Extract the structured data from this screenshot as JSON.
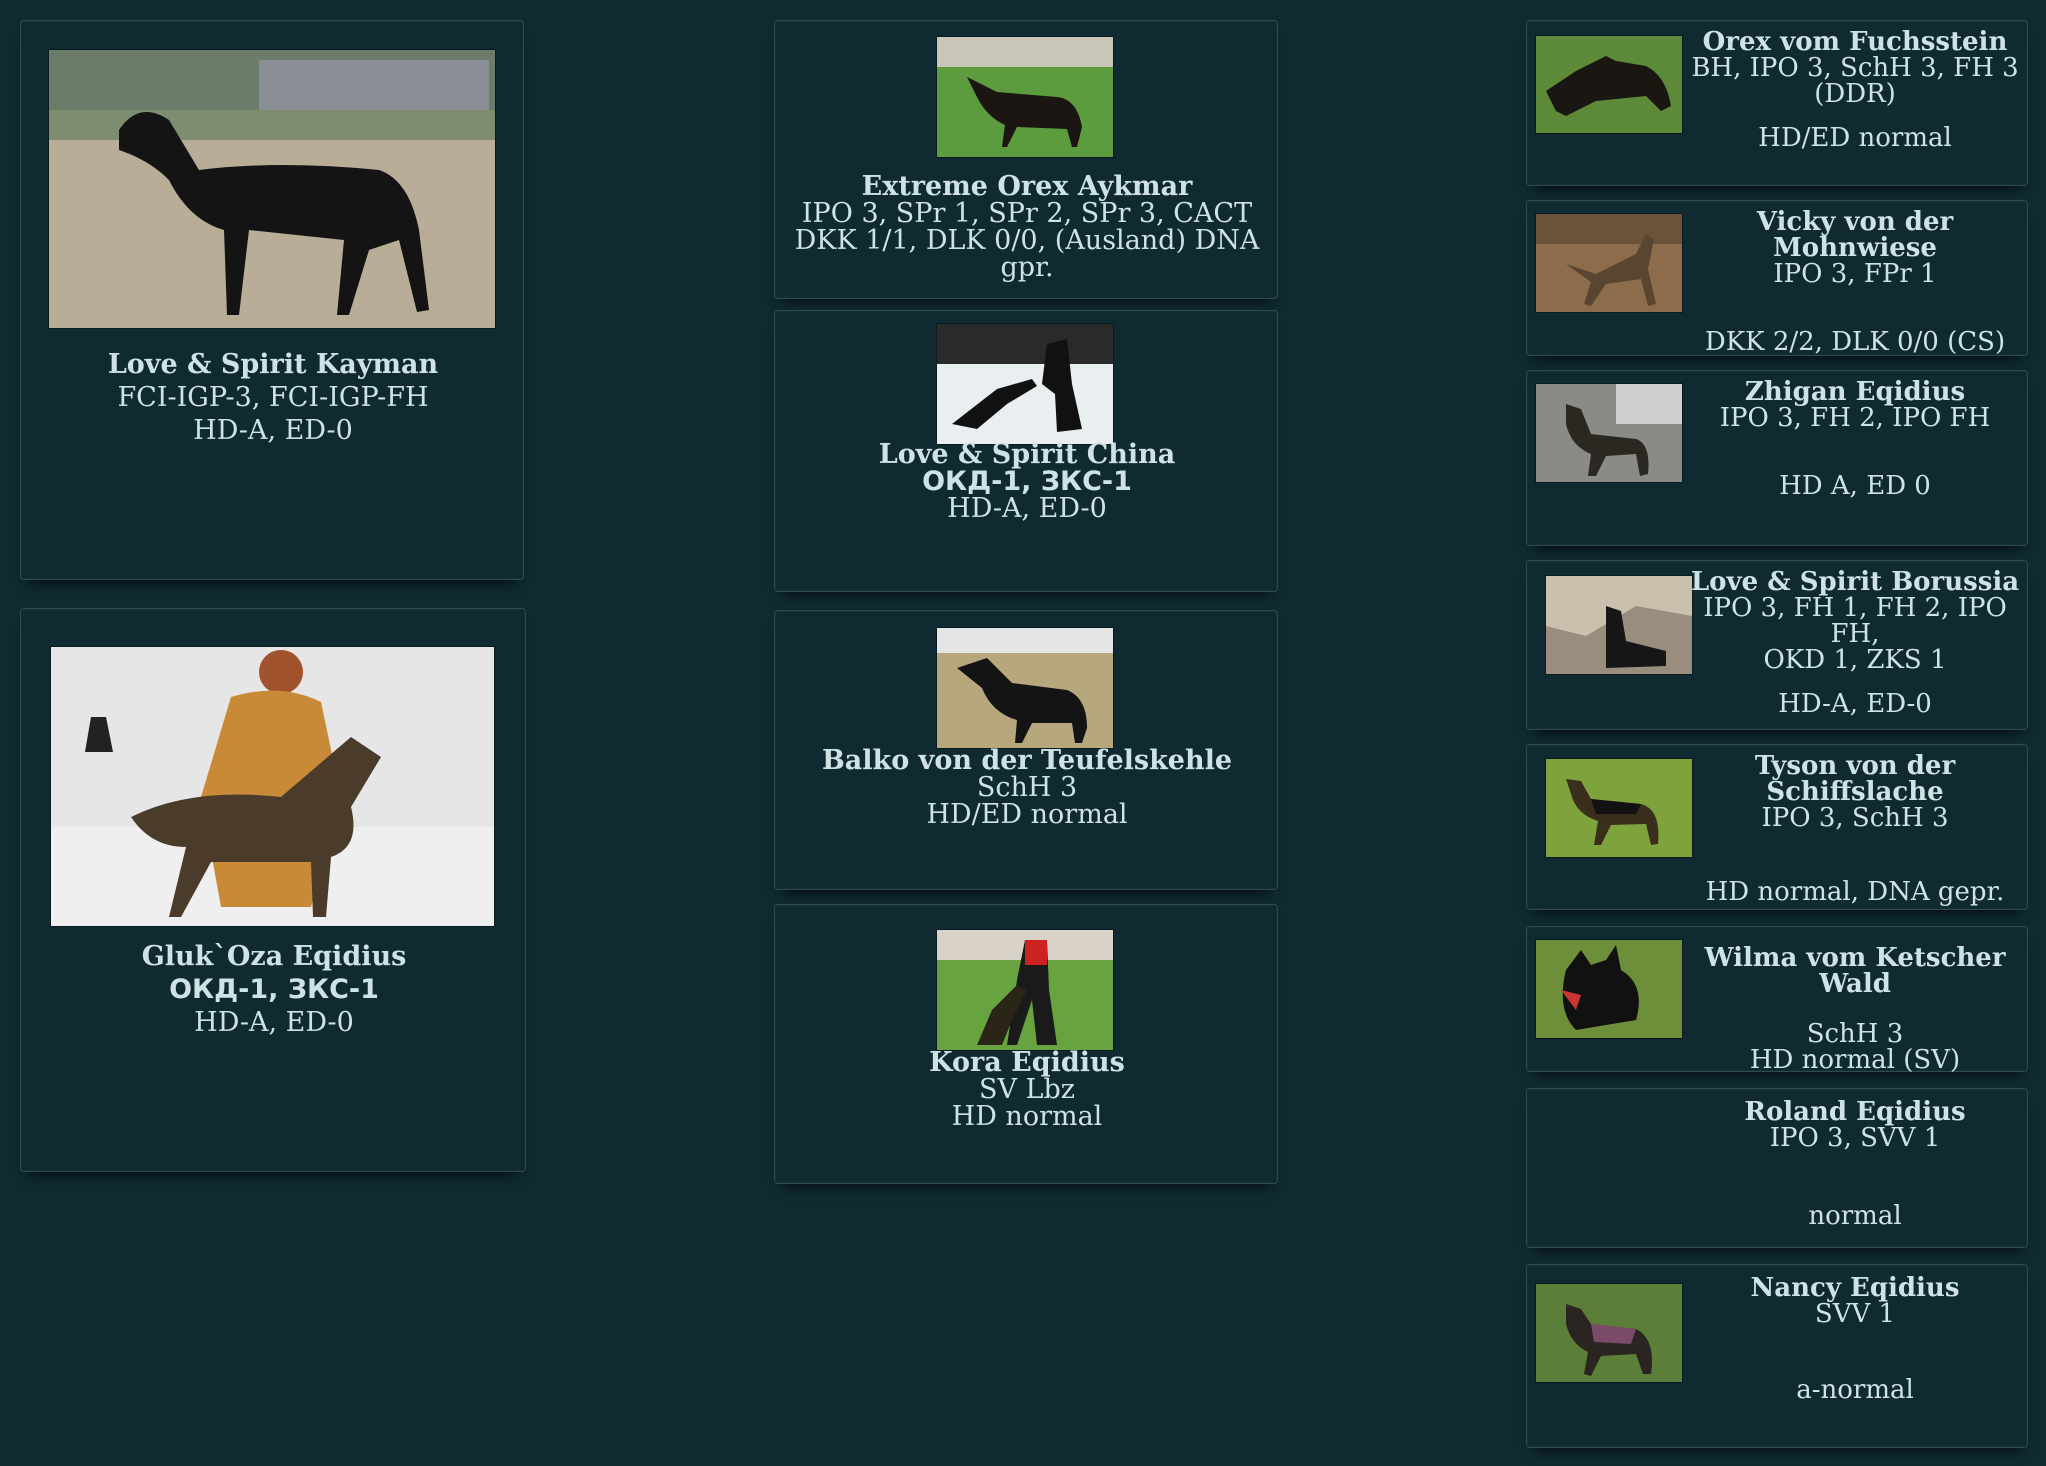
{
  "colors": {
    "background": "#0f2a31",
    "card_border": "#2c4b52",
    "text": "#cfe3e6"
  },
  "dogs": {
    "sire": {
      "name": "Love & Spirit Kayman",
      "titles": "FCI-IGP-3, FCI-IGP-FH",
      "health": "HD-A, ED-0"
    },
    "dam": {
      "name": "Gluk`Oza Eqidius",
      "titles_cyr": "ОКД-1, ЗКС-1",
      "health": "HD-A, ED-0"
    },
    "sire_sire": {
      "name": "Extreme Orex Aykmar",
      "titles": "IPO 3, SPr 1, SPr 2, SPr 3, CACT",
      "health": "DKK 1/1, DLK 0/0, (Ausland) DNA gpr."
    },
    "sire_dam": {
      "name": "Love & Spirit China",
      "titles_cyr": "ОКД-1, ЗКС-1",
      "health": "HD-A, ED-0"
    },
    "dam_sire": {
      "name": "Balko von der Teufelskehle",
      "titles": "SchH 3",
      "health": "HD/ED normal"
    },
    "dam_dam": {
      "name": "Kora Eqidius",
      "titles": "SV Lbz",
      "health": "HD normal"
    },
    "g3": [
      {
        "name": "Orex vom Fuchsstein",
        "titles": "BH, IPO 3, SchH 3, FH 3",
        "titles2": "(DDR)",
        "health": "HD/ED normal"
      },
      {
        "name": "Vicky von der Mohnwiese",
        "titles": "IPO 3, FPr 1",
        "titles2": "",
        "health": "DKK 2/2, DLK 0/0 (CS)"
      },
      {
        "name": "Zhigan Eqidius",
        "titles": "IPO 3, FH 2, IPO FH",
        "titles2": "",
        "health": "HD A, ED 0"
      },
      {
        "name": "Love & Spirit Borussia",
        "titles": "IPO 3, FH 1, FH 2, IPO FH,",
        "titles2": "OKD 1, ZKS 1",
        "health": "HD-A, ED-0"
      },
      {
        "name": "Tyson von der Schiffslache",
        "titles": "IPO 3, SchH 3",
        "titles2": "",
        "health": "HD normal, DNA gepr."
      },
      {
        "name": "Wilma vom Ketscher Wald",
        "titles": "SchH 3",
        "titles2": "",
        "health": "HD normal (SV)"
      },
      {
        "name": "Roland Eqidius",
        "titles": "IPO 3, SVV 1",
        "titles2": "",
        "health": "normal"
      },
      {
        "name": "Nancy Eqidius",
        "titles": "SVV 1",
        "titles2": "",
        "health": "a-normal"
      }
    ]
  }
}
